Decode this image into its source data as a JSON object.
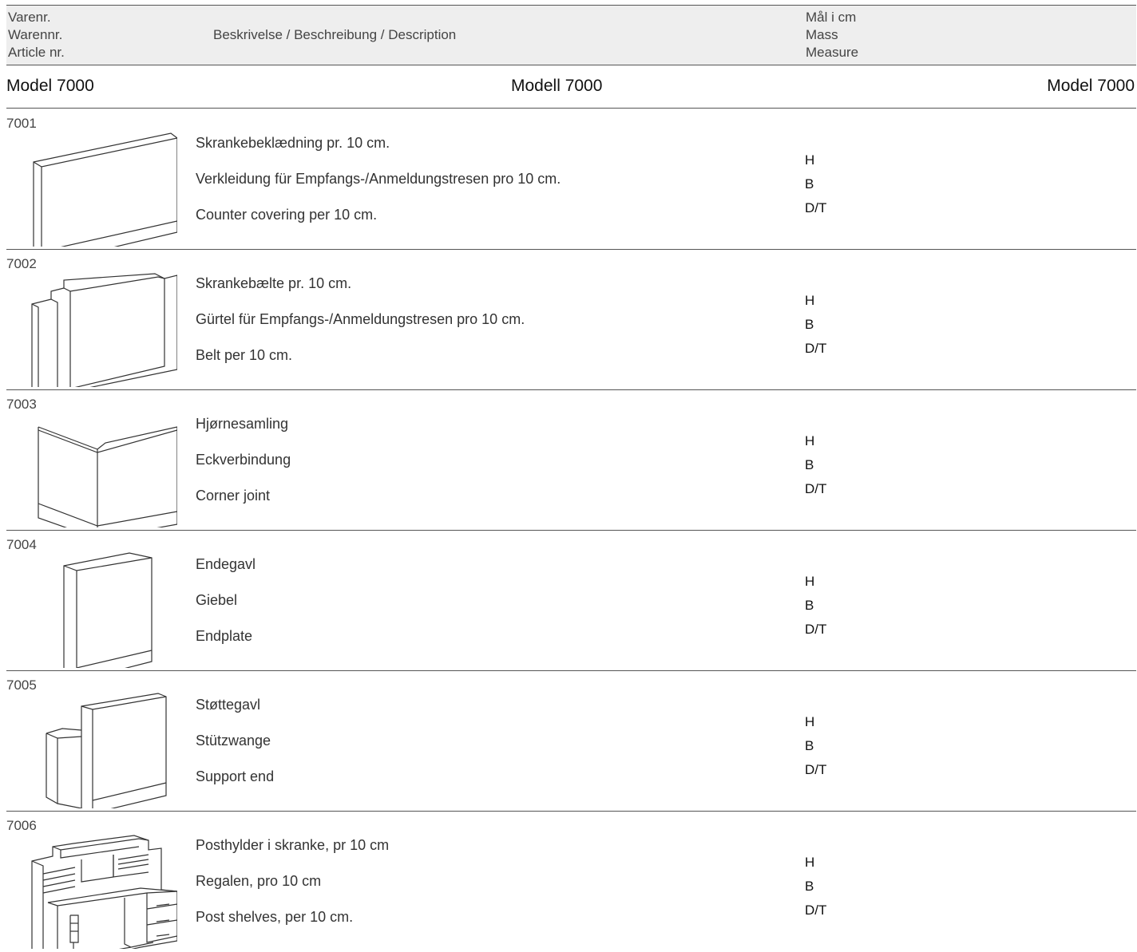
{
  "header": {
    "article_labels": [
      "Varenr.",
      "Warennr.",
      "Article nr."
    ],
    "description_label": "Beskrivelse / Beschreibung / Description",
    "measure_labels": [
      "Mål i cm",
      "Mass",
      "Measure"
    ]
  },
  "models": {
    "left": "Model 7000",
    "center": "Modell 7000",
    "right": "Model 7000"
  },
  "items": [
    {
      "number": "7001",
      "icon": "counter-covering-icon",
      "descriptions": [
        "Skrankebeklædning pr. 10 cm.",
        "Verkleidung für Empfangs-/Anmeldungstresen pro 10 cm.",
        "Counter covering per 10 cm."
      ],
      "dims": [
        "H",
        "B",
        "D/T"
      ]
    },
    {
      "number": "7002",
      "icon": "counter-belt-icon",
      "descriptions": [
        "Skrankebælte pr. 10 cm.",
        "Gürtel für Empfangs-/Anmeldungstresen pro 10 cm.",
        "Belt per 10 cm."
      ],
      "dims": [
        "H",
        "B",
        "D/T"
      ]
    },
    {
      "number": "7003",
      "icon": "corner-joint-icon",
      "descriptions": [
        "Hjørnesamling",
        "Eckverbindung",
        "Corner joint"
      ],
      "dims": [
        "H",
        "B",
        "D/T"
      ]
    },
    {
      "number": "7004",
      "icon": "endplate-icon",
      "descriptions": [
        "Endegavl",
        "Giebel",
        "Endplate"
      ],
      "dims": [
        "H",
        "B",
        "D/T"
      ]
    },
    {
      "number": "7005",
      "icon": "support-end-icon",
      "descriptions": [
        "Støttegavl",
        "Stützwange",
        "Support end"
      ],
      "dims": [
        "H",
        "B",
        "D/T"
      ]
    },
    {
      "number": "7006",
      "icon": "post-shelves-icon",
      "descriptions": [
        "Posthylder i skranke, pr 10 cm",
        "Regalen, pro 10 cm",
        "Post shelves, per 10 cm."
      ],
      "dims": [
        "H",
        "B",
        "D/T"
      ]
    }
  ]
}
